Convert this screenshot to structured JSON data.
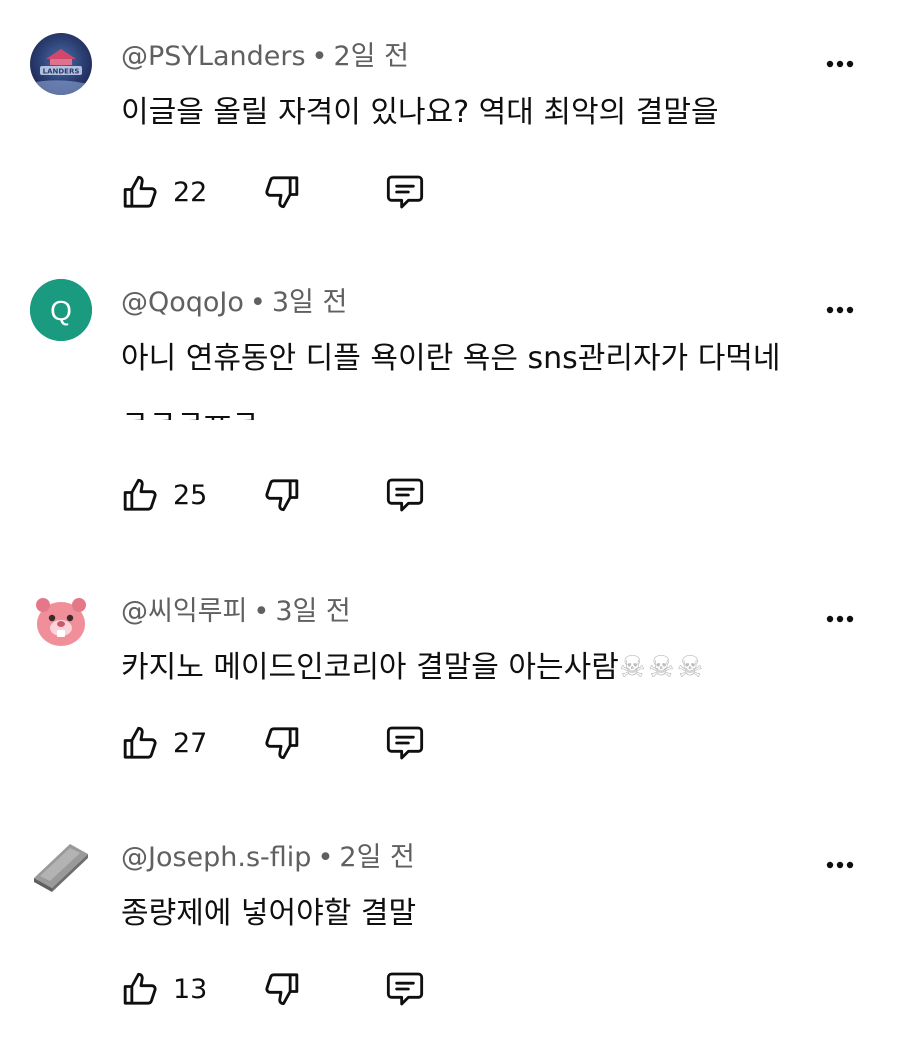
{
  "comments": [
    {
      "handle": "@PSYLanders",
      "separator": "•",
      "time": "2일 전",
      "text_lines": [
        "이글을 올릴 자격이 있나요? 역대 최악의 결말을"
      ],
      "likes": "22",
      "avatar_icon": "psylanders-logo-avatar",
      "avatar_text": "LANDERS"
    },
    {
      "handle": "@QoqoJo",
      "separator": "•",
      "time": "3일 전",
      "text_lines": [
        "아니 연휴동안 디플 욕이란 욕은 sns관리자가 다먹네",
        "ㅋㅋㅋㅠㅋ"
      ],
      "likes": "25",
      "avatar_letter": "Q",
      "avatar_color": "#1a9b7f"
    },
    {
      "handle": "@씨익루피",
      "separator": "•",
      "time": "3일 전",
      "text_lines": [
        "카지노 메이드인코리아 결말을 아는사람"
      ],
      "text_emoji": "☠☠☠",
      "likes": "27",
      "avatar_icon": "pink-beaver-avatar"
    },
    {
      "handle": "@Joseph.s-flip",
      "separator": "•",
      "time": "2일 전",
      "text_lines": [
        "종량제에 넣어야할 결말"
      ],
      "likes": "13",
      "avatar_icon": "metal-bar-avatar"
    }
  ],
  "icons": {
    "more": "more-vert-icon",
    "like": "thumbs-up-icon",
    "dislike": "thumbs-down-icon",
    "reply": "reply-comment-icon"
  }
}
